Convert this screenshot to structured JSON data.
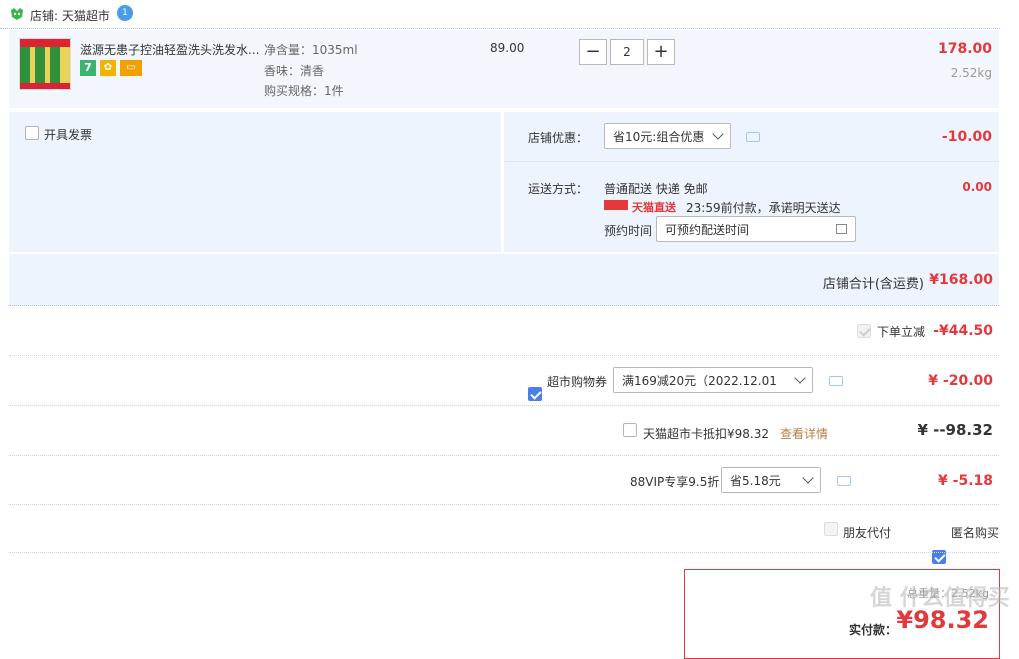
{
  "store": {
    "label": "店铺: 天猫超市",
    "badge": "1"
  },
  "item": {
    "title": "滋源无患子控油轻盈洗头洗发水...",
    "specs": [
      "净含量：1035ml",
      "香味：清香",
      "购买规格：1件"
    ],
    "price": "89.00",
    "qty": "2",
    "subtotal": "178.00",
    "weight": "2.52kg",
    "tags": [
      "7",
      "✿",
      "▭"
    ]
  },
  "invoice": {
    "label": "开具发票"
  },
  "discount": {
    "label": "店铺优惠：",
    "select": "省10元:组合优惠",
    "amount": "-10.00"
  },
  "delivery": {
    "label": "运送方式：",
    "method": "普通配送 快递 免邮",
    "tmall_direct": "天猫直送",
    "promise": "23:59前付款，承诺明天送达",
    "schedule_label": "预约时间",
    "schedule_placeholder": "可预约配送时间",
    "amount": "0.00"
  },
  "store_total": {
    "label": "店铺合计(含运费)",
    "amount": "¥168.00"
  },
  "instant_discount": {
    "label": "下单立减",
    "amount": "-¥44.50"
  },
  "coupon": {
    "label": "超市购物券",
    "select": "满169减20元（2022.12.01 ...",
    "amount": "¥ -20.00"
  },
  "card": {
    "label": "天猫超市卡抵扣¥98.32",
    "link": "查看详情",
    "amount": "¥ --98.32"
  },
  "vip": {
    "label": "88VIP专享9.5折",
    "select": "省5.18元",
    "amount": "¥ -5.18"
  },
  "options": {
    "friend_pay": "朋友代付",
    "anonymous": "匿名购买"
  },
  "final": {
    "weight": "总重量：2.52kg",
    "label": "实付款：",
    "amount": "¥98.32"
  },
  "watermark": "值 什么值得买",
  "colors": {
    "accent": "#e4393c",
    "checkbox": "#4a7ee8",
    "panel": "#eef4fd"
  }
}
